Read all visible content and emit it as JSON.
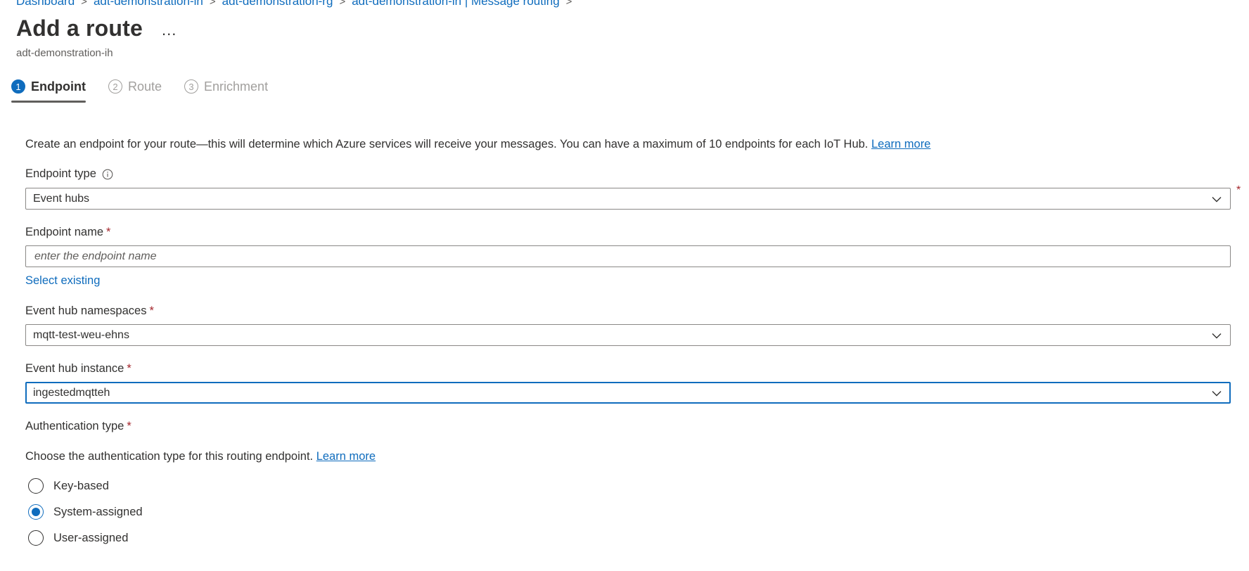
{
  "breadcrumb": [
    {
      "label": "Dashboard"
    },
    {
      "label": "adt-demonstration-ih"
    },
    {
      "label": "adt-demonstration-rg"
    },
    {
      "label": "adt-demonstration-ih | Message routing"
    }
  ],
  "page": {
    "title": "Add a route",
    "more_label": "...",
    "subtitle": "adt-demonstration-ih"
  },
  "steps": [
    {
      "num": "1",
      "label": "Endpoint",
      "active": true
    },
    {
      "num": "2",
      "label": "Route",
      "active": false
    },
    {
      "num": "3",
      "label": "Enrichment",
      "active": false
    }
  ],
  "intro": {
    "text": "Create an endpoint for your route—this will determine which Azure services will receive your messages. You can have a maximum of 10 endpoints for each IoT Hub.",
    "link": "Learn more"
  },
  "form": {
    "endpoint_type": {
      "label": "Endpoint type",
      "value": "Event hubs",
      "required_mark": "*"
    },
    "endpoint_name": {
      "label": "Endpoint name",
      "required_mark": "*",
      "value": "",
      "placeholder": "enter the endpoint name",
      "select_existing": "Select existing"
    },
    "namespaces": {
      "label": "Event hub namespaces",
      "required_mark": "*",
      "value": "mqtt-test-weu-ehns"
    },
    "instance": {
      "label": "Event hub instance",
      "required_mark": "*",
      "value": "ingestedmqtteh"
    },
    "auth": {
      "label": "Authentication type",
      "required_mark": "*",
      "description": "Choose the authentication type for this routing endpoint.",
      "link": "Learn more",
      "options": [
        {
          "label": "Key-based",
          "checked": false
        },
        {
          "label": "System-assigned",
          "checked": true
        },
        {
          "label": "User-assigned",
          "checked": false
        }
      ]
    }
  },
  "colors": {
    "accent": "#0f6cbd",
    "required": "#a4262c",
    "text": "#323130",
    "muted": "#605e5c"
  }
}
